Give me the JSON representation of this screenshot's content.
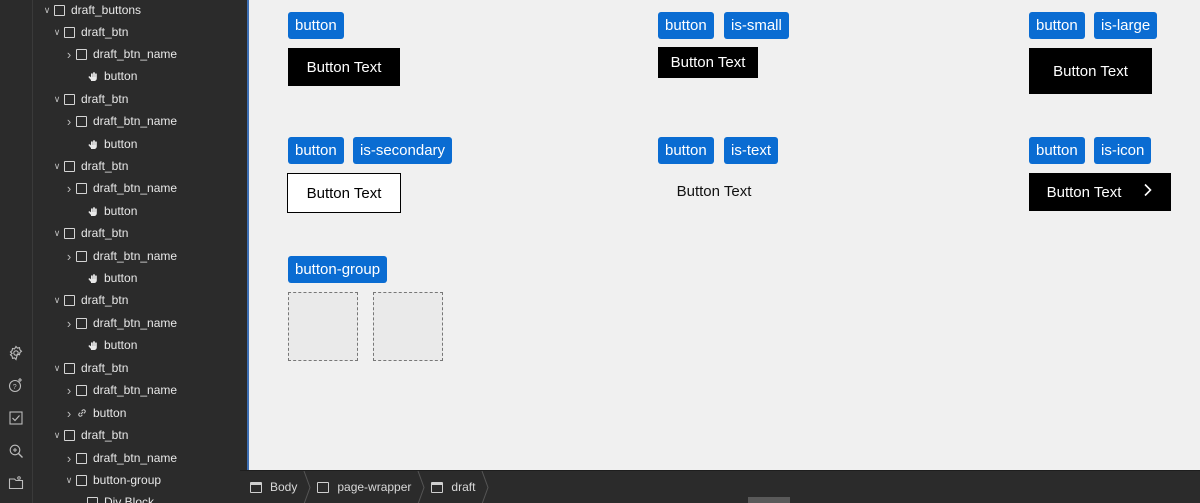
{
  "rail": {
    "icons": [
      "settings-icon",
      "interactions-icon",
      "audit-checklist-icon",
      "search-zoom-icon",
      "media-folder-icon"
    ]
  },
  "navigator": {
    "rows": [
      {
        "label": "draft_buttons",
        "chev": "down",
        "icon": "box"
      },
      {
        "label": "draft_btn",
        "chev": "down",
        "icon": "box"
      },
      {
        "label": "draft_btn_name",
        "chev": "right",
        "icon": "box"
      },
      {
        "label": "button",
        "chev": "",
        "icon": "hand"
      },
      {
        "label": "draft_btn",
        "chev": "down",
        "icon": "box"
      },
      {
        "label": "draft_btn_name",
        "chev": "right",
        "icon": "box"
      },
      {
        "label": "button",
        "chev": "",
        "icon": "hand"
      },
      {
        "label": "draft_btn",
        "chev": "down",
        "icon": "box"
      },
      {
        "label": "draft_btn_name",
        "chev": "right",
        "icon": "box"
      },
      {
        "label": "button",
        "chev": "",
        "icon": "hand"
      },
      {
        "label": "draft_btn",
        "chev": "down",
        "icon": "box"
      },
      {
        "label": "draft_btn_name",
        "chev": "right",
        "icon": "box"
      },
      {
        "label": "button",
        "chev": "",
        "icon": "hand"
      },
      {
        "label": "draft_btn",
        "chev": "down",
        "icon": "box"
      },
      {
        "label": "draft_btn_name",
        "chev": "right",
        "icon": "box"
      },
      {
        "label": "button",
        "chev": "",
        "icon": "hand"
      },
      {
        "label": "draft_btn",
        "chev": "down",
        "icon": "box"
      },
      {
        "label": "draft_btn_name",
        "chev": "right",
        "icon": "box"
      },
      {
        "label": "button",
        "chev": "right",
        "icon": "link"
      },
      {
        "label": "draft_btn",
        "chev": "down",
        "icon": "box"
      },
      {
        "label": "draft_btn_name",
        "chev": "right",
        "icon": "box"
      },
      {
        "label": "button-group",
        "chev": "down",
        "icon": "box"
      },
      {
        "label": "Div Block",
        "chev": "",
        "icon": "box"
      }
    ]
  },
  "canvas": {
    "tags": {
      "t1": "button",
      "t2": "button",
      "t3": "is-small",
      "t4": "button",
      "t5": "is-large",
      "t6": "button",
      "t7": "is-secondary",
      "t8": "button",
      "t9": "is-text",
      "t10": "button",
      "t11": "is-icon",
      "t12": "button-group"
    },
    "buttons": {
      "default": "Button Text",
      "small": "Button Text",
      "large": "Button Text",
      "secondary": "Button Text",
      "text": "Button Text",
      "icon": "Button Text"
    }
  },
  "breadcrumb": {
    "items": [
      "Body",
      "page-wrapper",
      "draft"
    ]
  },
  "colors": {
    "tag_blue": "#0a6cd2",
    "canvas_bg": "#f0f0f0",
    "panel_bg": "#2b2b2b",
    "accent": "#3d6fb4"
  }
}
